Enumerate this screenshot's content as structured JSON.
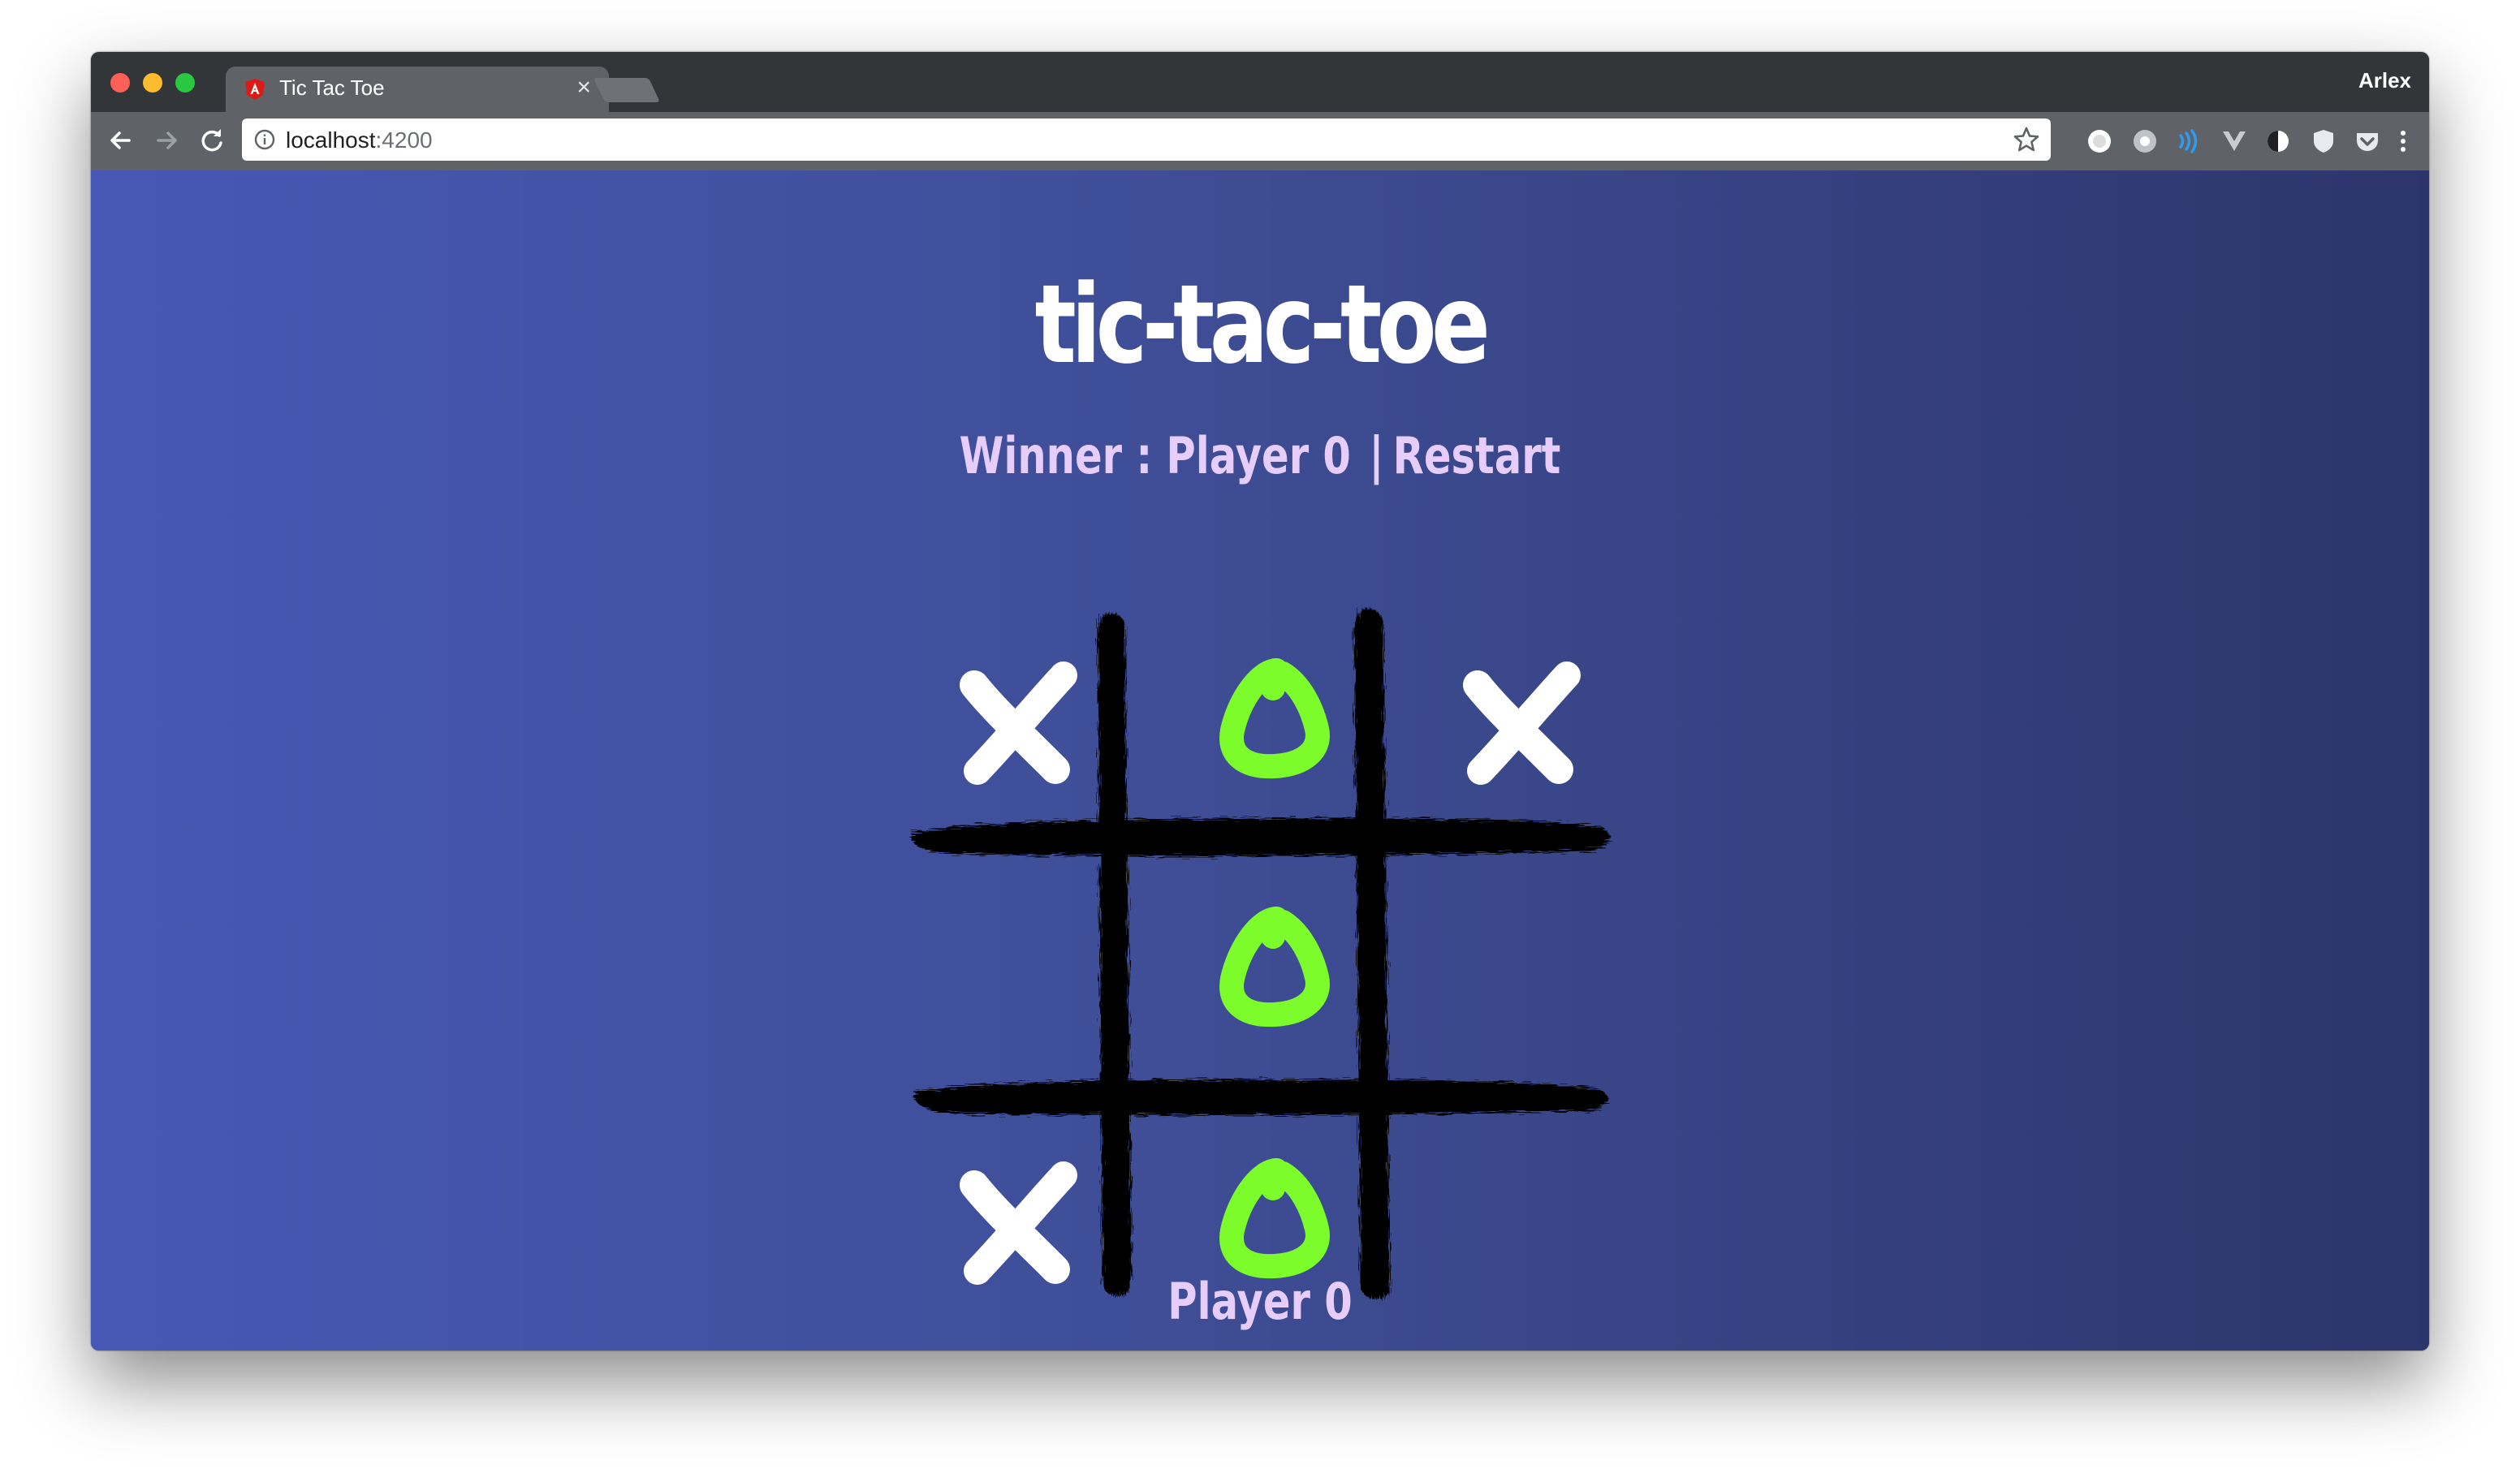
{
  "browser": {
    "tab_title": "Tic Tac Toe",
    "tab_close": "×",
    "profile_name": "Arlex",
    "url_host": "localhost",
    "url_port": ":4200"
  },
  "game": {
    "title": "tic-tac-toe",
    "winner_label": "Winner : Player 0",
    "separator": "|",
    "restart_label": "Restart",
    "current_player": "Player 0",
    "board": [
      "X",
      "O",
      "X",
      "",
      "O",
      "",
      "X",
      "O",
      ""
    ]
  },
  "colors": {
    "x_mark": "#ffffff",
    "o_mark": "#7cfc2a",
    "grid": "#000000",
    "label": "#e7cdfb"
  }
}
